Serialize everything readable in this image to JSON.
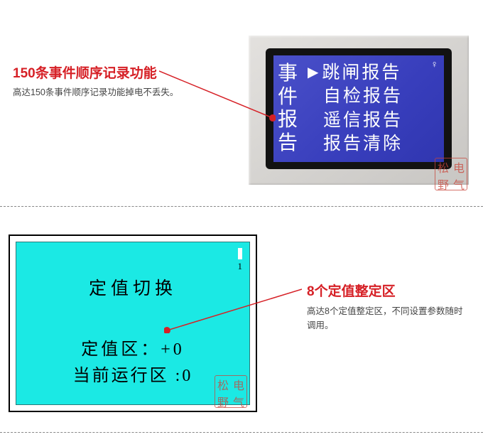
{
  "section1": {
    "title": "150条事件顺序记录功能",
    "desc": "高达150条事件顺序记录功能掉电不丢失。",
    "lcd": {
      "header_chars": [
        "事",
        "件",
        "报",
        "告"
      ],
      "menu": [
        "跳闸报告",
        "自检报告",
        "遥信报告",
        "报告清除"
      ],
      "corner": "♀"
    }
  },
  "section2": {
    "title": "8个定值整定区",
    "desc": "高达8个定值整定区，不同设置参数随时调用。",
    "lcd": {
      "title": "定值切换",
      "line2": "定值区：+0",
      "line3": "当前运行区 :0",
      "corner_label": "1"
    }
  },
  "stamp": {
    "c1": "松",
    "c2": "电",
    "c3": "野",
    "c4": "气"
  }
}
